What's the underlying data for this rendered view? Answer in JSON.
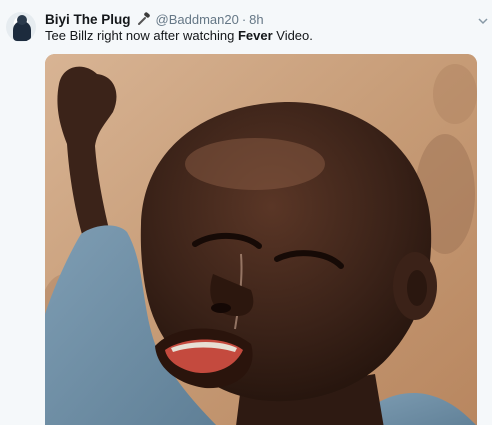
{
  "tweet": {
    "display_name": "Biyi The Plug",
    "name_emoji_icon": "microphone-icon",
    "handle": "@Baddman20",
    "separator": "·",
    "time": "8h",
    "text_before": "Tee Billz right now after watching ",
    "text_bold": "Fever",
    "text_after": " Video.",
    "more_icon": "chevron-down-icon"
  },
  "media": {
    "description_icon": "photo",
    "colors": {
      "wall": "#c99f7b",
      "skin": "#3a2318",
      "shirt": "#6f8fa6"
    }
  }
}
